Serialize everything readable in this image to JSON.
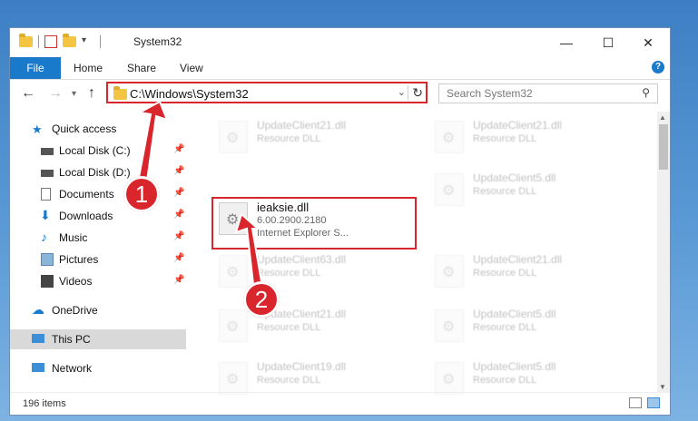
{
  "window": {
    "title": "System32",
    "controls": {
      "minimize": "—",
      "maximize": "☐",
      "close": "✕"
    }
  },
  "ribbon": {
    "tabs": [
      "File",
      "Home",
      "Share",
      "View"
    ],
    "help": "?"
  },
  "address_bar": {
    "path": "C:\\Windows\\System32",
    "dropdown": "⌄",
    "refresh": "↻"
  },
  "search": {
    "placeholder": "Search System32",
    "icon": "search-icon"
  },
  "sidebar": {
    "quick_access": "Quick access",
    "items": [
      {
        "label": "Local Disk (C:)",
        "icon": "drive-icon",
        "pinned": true
      },
      {
        "label": "Local Disk (D:)",
        "icon": "drive-icon",
        "pinned": true
      },
      {
        "label": "Documents",
        "icon": "documents-icon",
        "pinned": true
      },
      {
        "label": "Downloads",
        "icon": "downloads-icon",
        "pinned": true
      },
      {
        "label": "Music",
        "icon": "music-icon",
        "pinned": true
      },
      {
        "label": "Pictures",
        "icon": "pictures-icon",
        "pinned": true
      },
      {
        "label": "Videos",
        "icon": "videos-icon",
        "pinned": true
      }
    ],
    "onedrive": "OneDrive",
    "this_pc": "This PC",
    "network": "Network"
  },
  "files": {
    "left_column": [
      {
        "name": "UpdateClient21.dll",
        "type": "Resource DLL"
      },
      {
        "name": "UpdateClient63.dll",
        "type": "Resource DLL"
      },
      {
        "name": "UpdateClient21.dll",
        "type": "Resource DLL"
      },
      {
        "name": "UpdateClient19.dll",
        "type": "Resource DLL"
      }
    ],
    "right_column": [
      {
        "name": "UpdateClient21.dll",
        "type": "Resource DLL"
      },
      {
        "name": "UpdateClient5.dll",
        "type": "Resource DLL"
      },
      {
        "name": "UpdateClient21.dll",
        "type": "Resource DLL"
      },
      {
        "name": "UpdateClient5.dll",
        "type": "Resource DLL"
      },
      {
        "name": "UpdateClient5.dll",
        "type": "Resource DLL"
      }
    ],
    "highlighted": {
      "name": "ieaksie.dll",
      "version": "6.00.2900.2180",
      "description": "Internet Explorer S..."
    }
  },
  "status": {
    "item_count": "196 items"
  },
  "annotations": {
    "step1": "1",
    "step2": "2"
  },
  "colors": {
    "accent": "#1979ca",
    "highlight": "#d9262c"
  }
}
